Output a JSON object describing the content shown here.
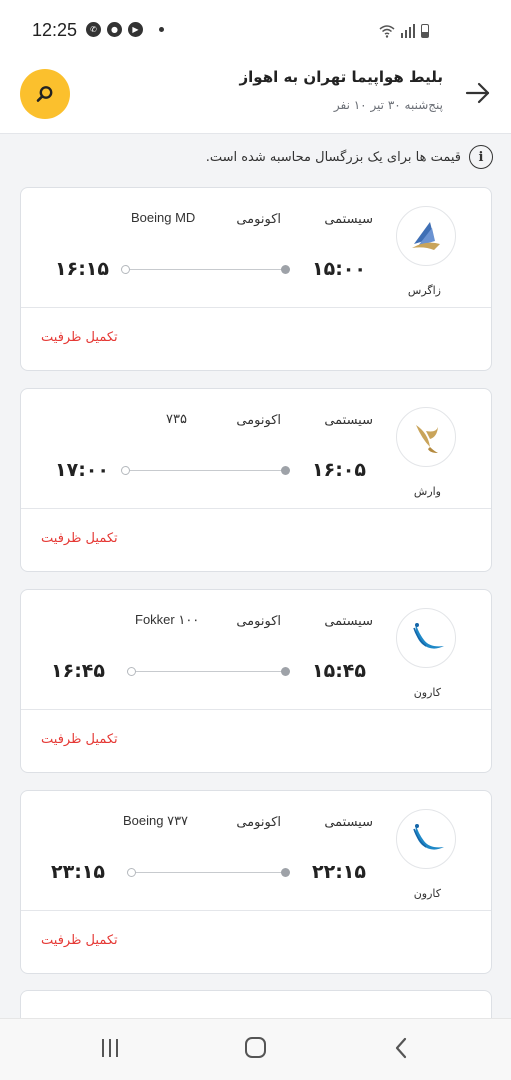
{
  "status_bar": {
    "time": "12:25",
    "notification_icons": [
      "whatsapp-icon",
      "app-badge-icon",
      "youtube-icon"
    ],
    "system_icons": [
      "wifi-icon",
      "signal-icon",
      "battery-icon"
    ]
  },
  "header": {
    "title": "بلیط هواپیما تهران به اهواز",
    "subtitle": "پنج‌شنبه ۳۰ تیر ۱۰ نفر"
  },
  "notice": {
    "text": "قیمت ها برای یک بزرگسال محاسبه شده است."
  },
  "flights": [
    {
      "airline": "زاگرس",
      "logo": "zagros-logo",
      "flight_type": "سیستمی",
      "cabin_class": "اکونومی",
      "aircraft": "Boeing MD",
      "departure_time": "۱۵:۰۰",
      "arrival_time": "۱۶:۱۵",
      "status": "تکمیل ظرفیت"
    },
    {
      "airline": "وارش",
      "logo": "varesh-logo",
      "flight_type": "سیستمی",
      "cabin_class": "اکونومی",
      "aircraft": "۷۳۵",
      "departure_time": "۱۶:۰۵",
      "arrival_time": "۱۷:۰۰",
      "status": "تکمیل ظرفیت"
    },
    {
      "airline": "کارون",
      "logo": "karun-logo",
      "flight_type": "سیستمی",
      "cabin_class": "اکونومی",
      "aircraft": "Fokker ۱۰۰",
      "departure_time": "۱۵:۴۵",
      "arrival_time": "۱۶:۴۵",
      "status": "تکمیل ظرفیت"
    },
    {
      "airline": "کارون",
      "logo": "karun-logo",
      "flight_type": "سیستمی",
      "cabin_class": "اکونومی",
      "aircraft": "Boeing ۷۳۷",
      "departure_time": "۲۲:۱۵",
      "arrival_time": "۲۳:۱۵",
      "status": "تکمیل ظرفیت"
    }
  ],
  "colors": {
    "accent": "#fbc02d",
    "status_full": "#e53935",
    "zagros_blue": "#3f6fb5",
    "zagros_gold": "#c9a45a",
    "varesh_gold": "#c9a45a",
    "karun_blue": "#1e88c7"
  },
  "nav_bar": {
    "buttons": [
      "recent-apps-icon",
      "home-icon",
      "back-icon"
    ]
  }
}
